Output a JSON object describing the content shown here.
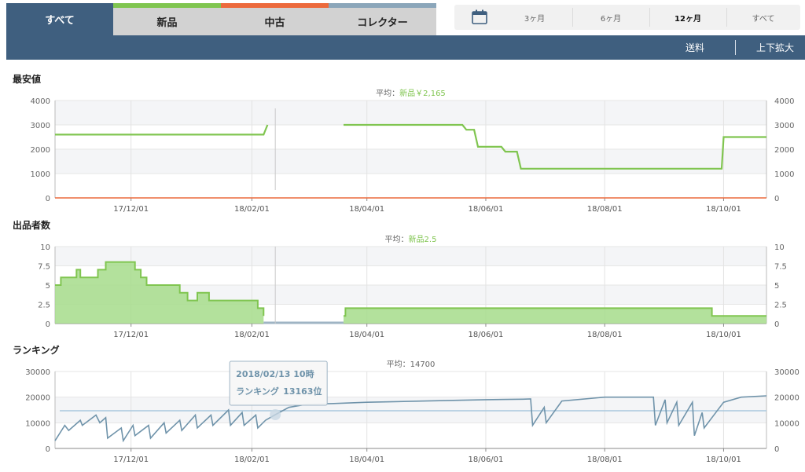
{
  "tabs": {
    "all": "すべて",
    "new": "新品",
    "used": "中古",
    "collector": "コレクター"
  },
  "toolbar": {
    "shipping": "送料",
    "zoom": "上下拡大"
  },
  "range": {
    "icon": "calendar-icon",
    "options": [
      "3ヶ月",
      "6ヶ月",
      "12ヶ月",
      "すべて"
    ],
    "selected": "12ヶ月"
  },
  "colors": {
    "new": "#80c550",
    "used": "#ec6a3c",
    "collector": "#8ba6ba",
    "ranking": "#6f93aa",
    "average_line": "#a9c8dd",
    "header": "#3f5f7f"
  },
  "chart_data": [
    {
      "id": "price",
      "type": "line",
      "title": "最安値",
      "average_label": "平均：",
      "average_value": "新品￥2,165",
      "x_ticks": [
        "17/12/01",
        "18/02/01",
        "18/04/01",
        "18/06/01",
        "18/08/01",
        "18/10/01"
      ],
      "x_range": [
        "2017-10-23",
        "2018-10-23"
      ],
      "ylim": [
        0,
        4000
      ],
      "y_ticks": [
        "0",
        "1000",
        "2000",
        "3000",
        "4000"
      ],
      "grid": true,
      "series": [
        {
          "name": "新品",
          "x": [
            "2017-10-23",
            "2018-02-07",
            "2018-02-09",
            "2018-03-20",
            "2018-05-20",
            "2018-05-22",
            "2018-05-26",
            "2018-05-28",
            "2018-06-09",
            "2018-06-11",
            "2018-06-17",
            "2018-06-19",
            "2018-09-30",
            "2018-10-01",
            "2018-10-23"
          ],
          "y": [
            2600,
            2600,
            3000,
            3000,
            3000,
            2800,
            2800,
            2100,
            2100,
            1900,
            1900,
            1200,
            1200,
            2500,
            2500
          ],
          "gaps": [
            [
              "2018-02-09",
              "2018-03-20"
            ]
          ]
        },
        {
          "name": "中古",
          "x": [
            "2017-10-23",
            "2018-10-23"
          ],
          "y": [
            0,
            0
          ]
        }
      ]
    },
    {
      "id": "sellers",
      "type": "area",
      "title": "出品者数",
      "average_label": "平均：",
      "average_value": "新品2.5",
      "x_ticks": [
        "17/12/01",
        "18/02/01",
        "18/04/01",
        "18/06/01",
        "18/08/01",
        "18/10/01"
      ],
      "x_range": [
        "2017-10-23",
        "2018-10-23"
      ],
      "ylim": [
        0,
        10
      ],
      "y_ticks": [
        "0",
        "2.5",
        "5",
        "7.5",
        "10"
      ],
      "grid": true,
      "series": [
        {
          "name": "新品",
          "x": [
            "2017-10-23",
            "2017-10-26",
            "2017-11-01",
            "2017-11-03",
            "2017-11-05",
            "2017-11-10",
            "2017-11-14",
            "2017-11-18",
            "2017-11-30",
            "2017-12-03",
            "2017-12-06",
            "2017-12-08",
            "2017-12-09",
            "2017-12-24",
            "2017-12-26",
            "2017-12-30",
            "2018-01-04",
            "2018-01-08",
            "2018-01-10",
            "2018-01-30",
            "2018-01-31",
            "2018-02-04",
            "2018-02-07",
            "2018-03-20",
            "2018-03-21",
            "2018-09-23",
            "2018-09-25",
            "2018-09-27",
            "2018-10-23"
          ],
          "y": [
            5,
            6,
            6,
            7,
            6,
            6,
            7,
            8,
            8,
            7,
            6,
            6,
            5,
            5,
            4,
            3,
            4,
            4,
            3,
            3,
            3,
            2,
            1,
            1,
            2,
            2,
            1,
            1,
            1
          ],
          "gaps": [
            [
              "2018-02-07",
              "2018-03-20"
            ]
          ]
        }
      ]
    },
    {
      "id": "ranking",
      "type": "line",
      "title": "ランキング",
      "average_label": "平均：",
      "average_value": "14700",
      "average": 14700,
      "x_ticks": [
        "17/12/01",
        "18/02/01",
        "18/04/01",
        "18/06/01",
        "18/08/01",
        "18/10/01"
      ],
      "x_range": [
        "2017-10-23",
        "2018-10-23"
      ],
      "ylim": [
        0,
        30000
      ],
      "y_ticks": [
        "0",
        "10000",
        "20000",
        "30000"
      ],
      "grid": true,
      "tooltip": {
        "date": "2018/02/13 10時",
        "label": "ランキング",
        "value": "13163位",
        "x": "2018-02-13",
        "y": 13163
      },
      "series": [
        {
          "name": "ランキング",
          "x": [
            "2017-10-23",
            "2017-10-28",
            "2017-10-30",
            "2017-11-05",
            "2017-11-06",
            "2017-11-13",
            "2017-11-15",
            "2017-11-18",
            "2017-11-19",
            "2017-11-26",
            "2017-11-27",
            "2017-12-02",
            "2017-12-03",
            "2017-12-10",
            "2017-12-11",
            "2017-12-18",
            "2017-12-19",
            "2017-12-26",
            "2017-12-27",
            "2018-01-03",
            "2018-01-04",
            "2018-01-11",
            "2018-01-12",
            "2018-01-20",
            "2018-01-21",
            "2018-01-27",
            "2018-01-28",
            "2018-02-03",
            "2018-02-04",
            "2018-02-08",
            "2018-02-13",
            "2018-02-20",
            "2018-03-01",
            "2018-03-15",
            "2018-04-01",
            "2018-05-01",
            "2018-06-01",
            "2018-06-20",
            "2018-06-24",
            "2018-06-25",
            "2018-07-01",
            "2018-07-02",
            "2018-07-10",
            "2018-08-01",
            "2018-08-26",
            "2018-08-27",
            "2018-09-01",
            "2018-09-02",
            "2018-09-07",
            "2018-09-08",
            "2018-09-15",
            "2018-09-16",
            "2018-09-20",
            "2018-09-21",
            "2018-09-25",
            "2018-10-01",
            "2018-10-10",
            "2018-10-23"
          ],
          "y": [
            3000,
            9000,
            7000,
            11000,
            9000,
            13000,
            10000,
            12000,
            4000,
            8000,
            3000,
            9000,
            5000,
            9000,
            4000,
            10000,
            6000,
            11000,
            7000,
            13000,
            8000,
            13000,
            9000,
            15000,
            9000,
            14000,
            9000,
            13000,
            8000,
            11000,
            13163,
            16000,
            17200,
            17500,
            18000,
            18500,
            19000,
            19200,
            19300,
            9000,
            16000,
            10000,
            18500,
            20000,
            20000,
            9000,
            19000,
            10000,
            18000,
            9000,
            18000,
            5000,
            14000,
            8000,
            12000,
            18000,
            20000,
            20500
          ]
        }
      ]
    }
  ]
}
